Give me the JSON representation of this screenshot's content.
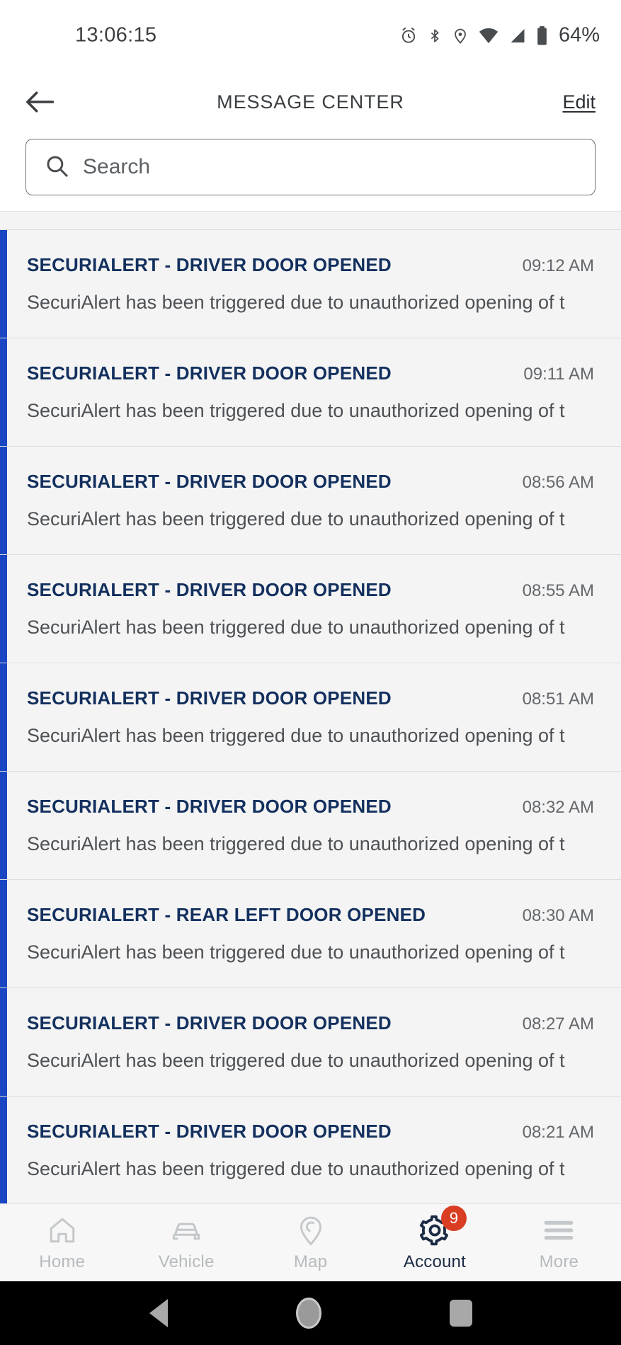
{
  "status_bar": {
    "time": "13:06:15",
    "battery_percent": "64%",
    "icons": [
      "alarm-icon",
      "bluetooth-icon",
      "location-icon",
      "wifi-icon",
      "signal-icon",
      "battery-icon"
    ]
  },
  "header": {
    "back_icon": "back-arrow-icon",
    "title": "MESSAGE CENTER",
    "edit_label": "Edit"
  },
  "search": {
    "icon": "search-icon",
    "placeholder": "Search",
    "value": ""
  },
  "messages": {
    "body_text": "SecuriAlert has been triggered due to unauthorized opening of t",
    "items": [
      {
        "title": "SECURIALERT - DRIVER DOOR OPENED",
        "time": "",
        "body": "SecuriAlert has been triggered due to unauthorized opening of t",
        "unread": false,
        "partial": true
      },
      {
        "title": "SECURIALERT - DRIVER DOOR OPENED",
        "time": "09:12 AM",
        "body": "SecuriAlert has been triggered due to unauthorized opening of t",
        "unread": true,
        "partial": false
      },
      {
        "title": "SECURIALERT - DRIVER DOOR OPENED",
        "time": "09:11 AM",
        "body": "SecuriAlert has been triggered due to unauthorized opening of t",
        "unread": true,
        "partial": false
      },
      {
        "title": "SECURIALERT - DRIVER DOOR OPENED",
        "time": "08:56 AM",
        "body": "SecuriAlert has been triggered due to unauthorized opening of t",
        "unread": true,
        "partial": false
      },
      {
        "title": "SECURIALERT - DRIVER DOOR OPENED",
        "time": "08:55 AM",
        "body": "SecuriAlert has been triggered due to unauthorized opening of t",
        "unread": true,
        "partial": false
      },
      {
        "title": "SECURIALERT - DRIVER DOOR OPENED",
        "time": "08:51 AM",
        "body": "SecuriAlert has been triggered due to unauthorized opening of t",
        "unread": true,
        "partial": false
      },
      {
        "title": "SECURIALERT - DRIVER DOOR OPENED",
        "time": "08:32 AM",
        "body": "SecuriAlert has been triggered due to unauthorized opening of t",
        "unread": true,
        "partial": false
      },
      {
        "title": "SECURIALERT - REAR LEFT DOOR OPENED",
        "time": "08:30 AM",
        "body": "SecuriAlert has been triggered due to unauthorized opening of t",
        "unread": true,
        "partial": false
      },
      {
        "title": "SECURIALERT - DRIVER DOOR OPENED",
        "time": "08:27 AM",
        "body": "SecuriAlert has been triggered due to unauthorized opening of t",
        "unread": true,
        "partial": false
      },
      {
        "title": "SECURIALERT - DRIVER DOOR OPENED",
        "time": "08:21 AM",
        "body": "SecuriAlert has been triggered due to unauthorized opening of t",
        "unread": true,
        "partial": false
      }
    ]
  },
  "bottom_nav": {
    "items": [
      {
        "label": "Home",
        "icon": "home-icon",
        "active": false,
        "badge": ""
      },
      {
        "label": "Vehicle",
        "icon": "car-icon",
        "active": false,
        "badge": ""
      },
      {
        "label": "Map",
        "icon": "map-pin-icon",
        "active": false,
        "badge": ""
      },
      {
        "label": "Account",
        "icon": "gear-icon",
        "active": true,
        "badge": "9"
      },
      {
        "label": "More",
        "icon": "hamburger-icon",
        "active": false,
        "badge": ""
      }
    ]
  },
  "system_nav": {
    "back": "system-back-icon",
    "home": "system-home-icon",
    "recents": "system-recents-icon"
  },
  "colors": {
    "unread_stripe": "#1a46c4",
    "title_blue": "#13305e",
    "badge_red": "#d93d22",
    "list_bg": "#f4f4f4"
  }
}
